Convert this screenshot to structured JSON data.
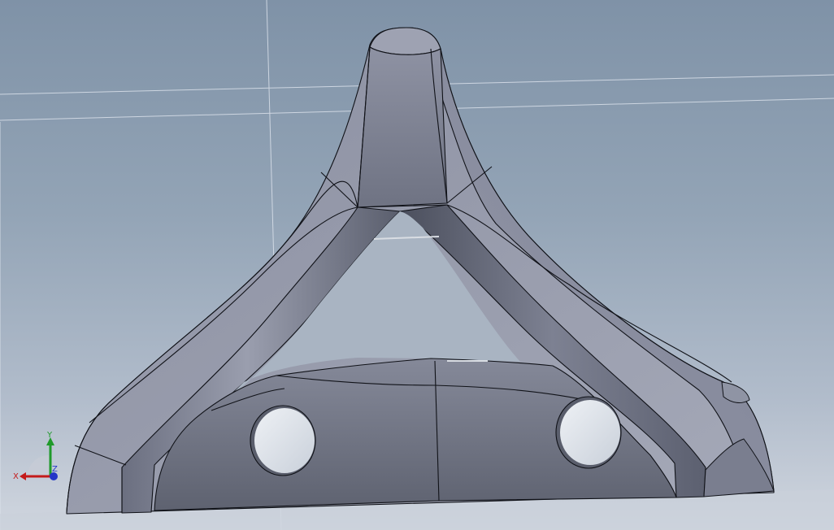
{
  "viewport": {
    "triad": {
      "x_label": "X",
      "y_label": "Y",
      "z_label": "Z",
      "x_color": "#c41a1a",
      "y_color": "#1f9a2a",
      "z_color": "#2436c8"
    },
    "colors": {
      "background_top": "#7f92a7",
      "background_bottom": "#d0d6df",
      "part_surface": "#7d8192",
      "part_edge": "#101218"
    }
  }
}
